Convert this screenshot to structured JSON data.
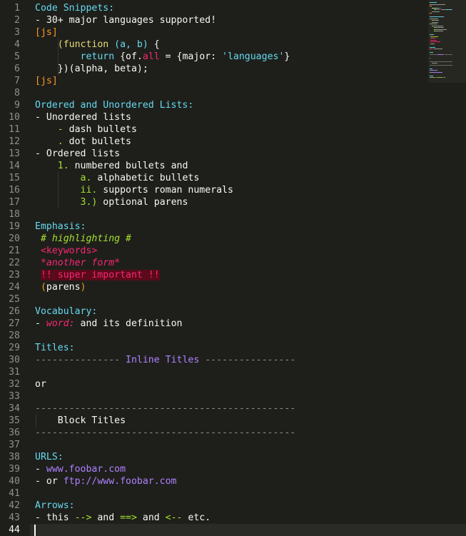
{
  "editor": {
    "active_line": 44,
    "line_numbers": [
      "1",
      "2",
      "3",
      "4",
      "5",
      "6",
      "7",
      "8",
      "9",
      "10",
      "11",
      "12",
      "13",
      "14",
      "15",
      "16",
      "17",
      "18",
      "19",
      "20",
      "21",
      "22",
      "23",
      "24",
      "25",
      "26",
      "27",
      "28",
      "29",
      "30",
      "31",
      "32",
      "33",
      "34",
      "35",
      "36",
      "37",
      "38",
      "39",
      "40",
      "41",
      "42",
      "43",
      "44"
    ],
    "lines": [
      [
        {
          "t": "Code Snippets:",
          "c": "head"
        }
      ],
      [
        {
          "t": "- 30+ major languages supported!",
          "c": "w"
        }
      ],
      [
        {
          "t": "[js]",
          "c": "o"
        }
      ],
      [
        {
          "t": "    ",
          "c": "w"
        },
        {
          "t": "(function ",
          "c": "y"
        },
        {
          "t": "(a, b)",
          "c": "b"
        },
        {
          "t": " {",
          "c": "w"
        }
      ],
      [
        {
          "t": "        ",
          "c": "w"
        },
        {
          "t": "return ",
          "c": "b"
        },
        {
          "t": "{of.",
          "c": "w"
        },
        {
          "t": "all",
          "c": "r"
        },
        {
          "t": " = {major: ",
          "c": "w"
        },
        {
          "t": "'languages'",
          "c": "b"
        },
        {
          "t": "}",
          "c": "w"
        }
      ],
      [
        {
          "t": "    })(alpha, beta);",
          "c": "w"
        }
      ],
      [
        {
          "t": "[js]",
          "c": "o"
        }
      ],
      [],
      [
        {
          "t": "Ordered and Unordered Lists:",
          "c": "head"
        }
      ],
      [
        {
          "t": "- Unordered lists",
          "c": "w"
        }
      ],
      [
        {
          "t": "    ",
          "c": "w"
        },
        {
          "t": "- ",
          "c": "g"
        },
        {
          "t": "dash bullets",
          "c": "w"
        }
      ],
      [
        {
          "t": "    ",
          "c": "w"
        },
        {
          "t": ". ",
          "c": "g"
        },
        {
          "t": "dot bullets",
          "c": "w"
        }
      ],
      [
        {
          "t": "- Ordered lists",
          "c": "w"
        }
      ],
      [
        {
          "t": "    ",
          "c": "w"
        },
        {
          "t": "1. ",
          "c": "g"
        },
        {
          "t": "numbered bullets and",
          "c": "w"
        }
      ],
      [
        {
          "t": "        ",
          "c": "w"
        },
        {
          "t": "a. ",
          "c": "g"
        },
        {
          "t": "alphabetic bullets",
          "c": "w"
        }
      ],
      [
        {
          "t": "        ",
          "c": "w"
        },
        {
          "t": "ii. ",
          "c": "g"
        },
        {
          "t": "supports roman numerals",
          "c": "w"
        }
      ],
      [
        {
          "t": "        ",
          "c": "w"
        },
        {
          "t": "3.) ",
          "c": "g"
        },
        {
          "t": "optional parens",
          "c": "w"
        }
      ],
      [],
      [
        {
          "t": "Emphasis:",
          "c": "head"
        }
      ],
      [
        {
          "t": " ",
          "c": "w"
        },
        {
          "t": "# highlighting #",
          "c": "gi"
        }
      ],
      [
        {
          "t": " ",
          "c": "w"
        },
        {
          "t": "<keywords>",
          "c": "r"
        }
      ],
      [
        {
          "t": " ",
          "c": "w"
        },
        {
          "t": "*another form*",
          "c": "ri"
        }
      ],
      [
        {
          "t": " ",
          "c": "w"
        },
        {
          "t": "!! super important !!",
          "c": "imp"
        }
      ],
      [
        {
          "t": " ",
          "c": "w"
        },
        {
          "t": "(",
          "c": "o"
        },
        {
          "t": "parens",
          "c": "w"
        },
        {
          "t": ")",
          "c": "o"
        }
      ],
      [],
      [
        {
          "t": "Vocabulary:",
          "c": "head"
        }
      ],
      [
        {
          "t": "- ",
          "c": "w"
        },
        {
          "t": "word:",
          "c": "ri"
        },
        {
          "t": " and its definition",
          "c": "w"
        }
      ],
      [],
      [
        {
          "t": "Titles:",
          "c": "head"
        }
      ],
      [
        {
          "t": "--------------- ",
          "c": "dim"
        },
        {
          "t": "Inline Titles",
          "c": "p"
        },
        {
          "t": " ----------------",
          "c": "dim"
        }
      ],
      [],
      [
        {
          "t": "or",
          "c": "w"
        }
      ],
      [],
      [
        {
          "t": "----------------------------------------------",
          "c": "dim"
        }
      ],
      [
        {
          "t": "    Block Titles",
          "c": "w"
        }
      ],
      [
        {
          "t": "----------------------------------------------",
          "c": "dim"
        }
      ],
      [],
      [
        {
          "t": "URLS:",
          "c": "head"
        }
      ],
      [
        {
          "t": "- ",
          "c": "w"
        },
        {
          "t": "www.foobar.com",
          "c": "p"
        }
      ],
      [
        {
          "t": "- or ",
          "c": "w"
        },
        {
          "t": "ftp://www.foobar.com",
          "c": "p"
        }
      ],
      [],
      [
        {
          "t": "Arrows:",
          "c": "head"
        }
      ],
      [
        {
          "t": "- this ",
          "c": "w"
        },
        {
          "t": "-->",
          "c": "g"
        },
        {
          "t": " and ",
          "c": "w"
        },
        {
          "t": "==>",
          "c": "g"
        },
        {
          "t": " and ",
          "c": "w"
        },
        {
          "t": "<--",
          "c": "g"
        },
        {
          "t": " etc.",
          "c": "w"
        }
      ],
      []
    ]
  }
}
